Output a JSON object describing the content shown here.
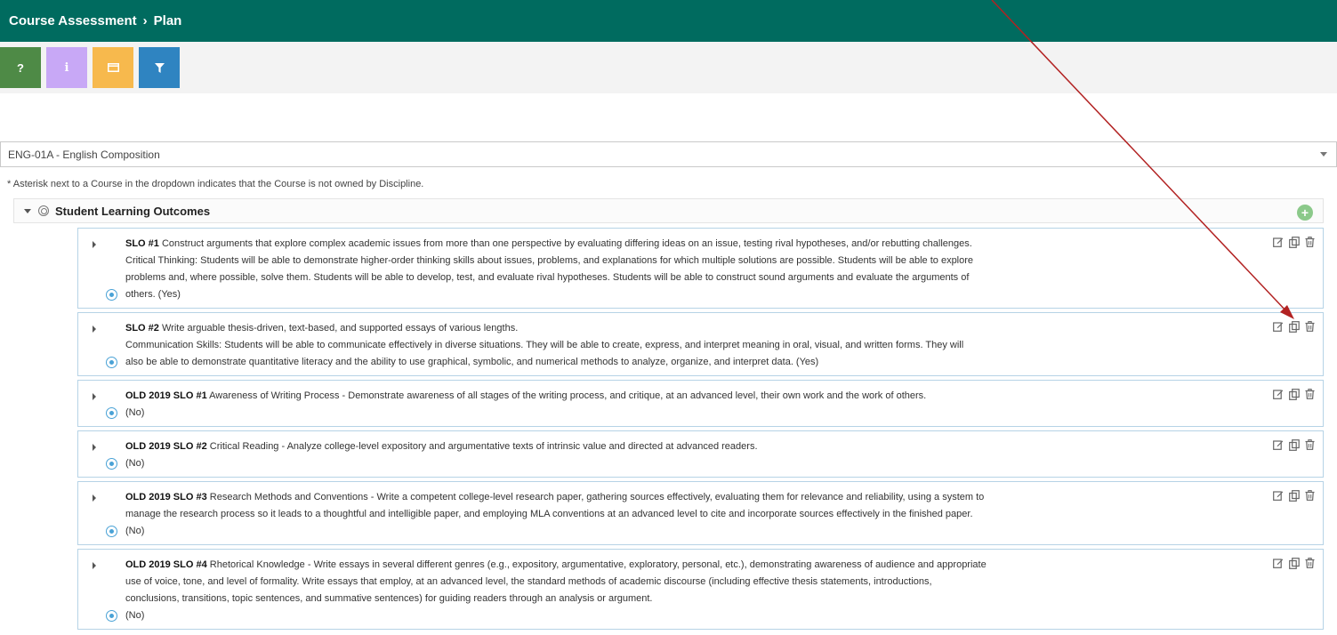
{
  "breadcrumb": {
    "parent": "Course Assessment",
    "separator": "›",
    "current": "Plan"
  },
  "toolbar": [
    {
      "icon": "question-icon",
      "glyph": "?",
      "color": "#4e8a46"
    },
    {
      "icon": "info-icon",
      "glyph": "i",
      "color": "#c8a8f6"
    },
    {
      "icon": "window-icon",
      "glyph": "",
      "color": "#f7b94d"
    },
    {
      "icon": "filter-icon",
      "glyph": "",
      "color": "#2f84c1"
    }
  ],
  "course_select": {
    "value": "ENG-01A - English Composition"
  },
  "note": "* Asterisk next to a Course in the dropdown indicates that the Course is not owned by Discipline.",
  "outcomes": {
    "header": "Student Learning Outcomes",
    "items": [
      {
        "code": "SLO #1",
        "lines": [
          "Construct arguments that explore complex academic issues from more than one perspective by evaluating differing ideas on an issue, testing rival hypotheses, and/or rebutting challenges.",
          "Critical Thinking: Students will be able to demonstrate higher-order thinking skills about issues, problems, and explanations for which multiple solutions are possible. Students will be able to explore",
          "problems and, where possible, solve them. Students will be able to develop, test, and evaluate rival hypotheses. Students will be able to construct sound arguments and evaluate the arguments of",
          "others. (Yes)"
        ]
      },
      {
        "code": "SLO #2",
        "lines": [
          "Write arguable thesis-driven, text-based, and supported essays of various lengths.",
          "Communication Skills: Students will be able to communicate effectively in diverse situations. They will be able to create, express, and interpret meaning in oral, visual, and written forms. They will",
          "also be able to demonstrate quantitative literacy and the ability to use graphical, symbolic, and numerical methods to analyze, organize, and interpret data. (Yes)"
        ]
      },
      {
        "code": "OLD 2019 SLO #1",
        "lines": [
          "Awareness of Writing Process - Demonstrate awareness of all stages of the writing process, and critique, at an advanced level, their own work and the work of others.",
          "(No)"
        ]
      },
      {
        "code": "OLD 2019 SLO #2",
        "lines": [
          "Critical Reading - Analyze college-level expository and argumentative texts of intrinsic value and directed at advanced readers.",
          "(No)"
        ]
      },
      {
        "code": "OLD 2019 SLO #3",
        "lines": [
          "Research Methods and Conventions - Write a competent college-level research paper, gathering sources effectively, evaluating them for relevance and reliability, using a system to",
          "manage the research process so it leads to a thoughtful and intelligible paper, and employing MLA conventions at an advanced level to cite and incorporate sources effectively in the finished paper.",
          "(No)"
        ]
      },
      {
        "code": "OLD 2019 SLO #4",
        "lines": [
          "Rhetorical Knowledge - Write essays in several different genres (e.g., expository, argumentative, exploratory, personal, etc.), demonstrating awareness of audience and appropriate",
          "use of voice, tone, and level of formality. Write essays that employ, at an advanced level, the standard methods of academic discourse (including effective thesis statements, introductions,",
          "conclusions, transitions, topic sentences, and summative sentences) for guiding readers through an analysis or argument.",
          "(No)"
        ]
      }
    ]
  },
  "annotation": {
    "color": "#b22222"
  }
}
